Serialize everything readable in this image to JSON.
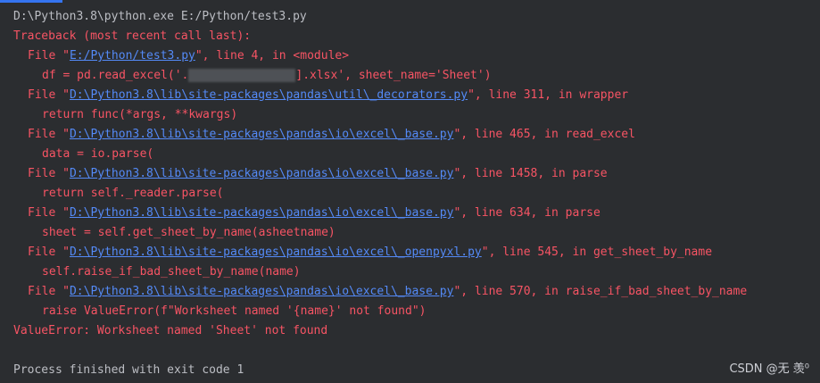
{
  "command_line": "D:\\Python3.8\\python.exe E:/Python/test3.py",
  "traceback_header": "Traceback (most recent call last):",
  "frames": [
    {
      "prefix": "File \"",
      "path": "E:/Python/test3.py",
      "suffix": "\", line 4, in <module>",
      "code_before": "df = pd.read_excel('.",
      "code_after": "].xlsx', sheet_name='Sheet')"
    },
    {
      "prefix": "File \"",
      "path": "D:\\Python3.8\\lib\\site-packages\\pandas\\util\\_decorators.py",
      "suffix": "\", line 311, in wrapper",
      "code": "return func(*args, **kwargs)"
    },
    {
      "prefix": "File \"",
      "path": "D:\\Python3.8\\lib\\site-packages\\pandas\\io\\excel\\_base.py",
      "suffix": "\", line 465, in read_excel",
      "code": "data = io.parse("
    },
    {
      "prefix": "File \"",
      "path": "D:\\Python3.8\\lib\\site-packages\\pandas\\io\\excel\\_base.py",
      "suffix": "\", line 1458, in parse",
      "code": "return self._reader.parse("
    },
    {
      "prefix": "File \"",
      "path": "D:\\Python3.8\\lib\\site-packages\\pandas\\io\\excel\\_base.py",
      "suffix": "\", line 634, in parse",
      "code": "sheet = self.get_sheet_by_name(asheetname)"
    },
    {
      "prefix": "File \"",
      "path": "D:\\Python3.8\\lib\\site-packages\\pandas\\io\\excel\\_openpyxl.py",
      "suffix": "\", line 545, in get_sheet_by_name",
      "code": "self.raise_if_bad_sheet_by_name(name)"
    },
    {
      "prefix": "File \"",
      "path": "D:\\Python3.8\\lib\\site-packages\\pandas\\io\\excel\\_base.py",
      "suffix": "\", line 570, in raise_if_bad_sheet_by_name",
      "code": "raise ValueError(f\"Worksheet named '{name}' not found\")"
    }
  ],
  "error_message": "ValueError: Worksheet named 'Sheet' not found",
  "exit_message": "Process finished with exit code 1",
  "watermark": "CSDN @无 羡⁰",
  "colors": {
    "background": "#2b2d30",
    "command_text": "#bcbec4",
    "error_text": "#f75464",
    "link": "#548af7",
    "accent": "#3574f0"
  }
}
